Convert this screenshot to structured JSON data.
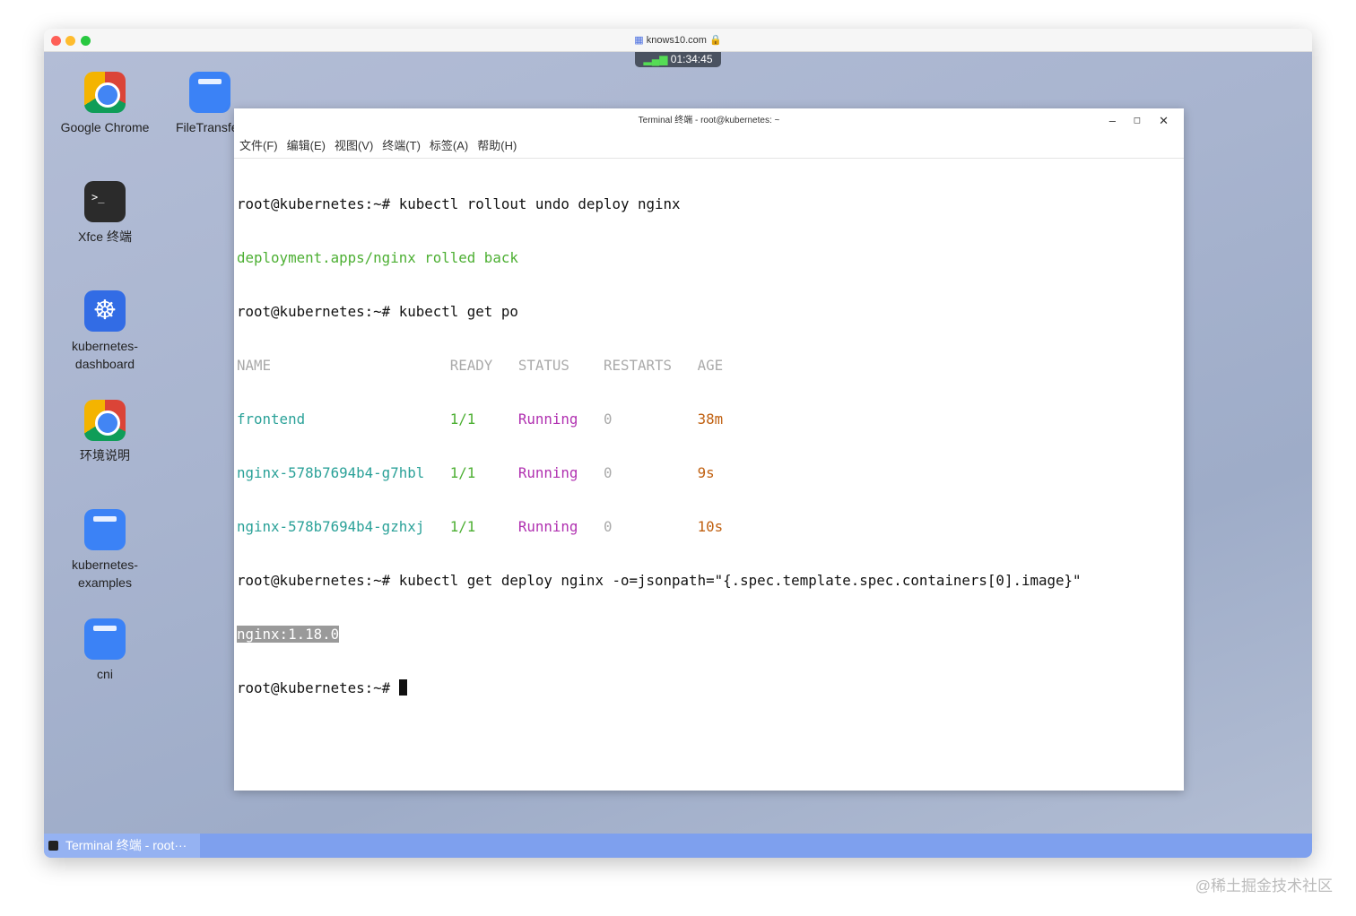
{
  "browser": {
    "url": "knows10.com",
    "timer": "01:34:45"
  },
  "desktop_icons": [
    {
      "label": "Google Chrome"
    },
    {
      "label": "FileTransfer"
    },
    {
      "label": "Xfce 终端"
    },
    {
      "label": "kubernetes-dashboard"
    },
    {
      "label": "环境说明"
    },
    {
      "label": "kubernetes-examples"
    },
    {
      "label": "cni"
    }
  ],
  "terminal": {
    "title": "Terminal 终端 - root@kubernetes: ~",
    "menu": [
      "文件(F)",
      "编辑(E)",
      "视图(V)",
      "终端(T)",
      "标签(A)",
      "帮助(H)"
    ],
    "lines": {
      "l1": "root@kubernetes:~# kubectl rollout undo deploy nginx",
      "l2": "deployment.apps/nginx rolled back",
      "l3": "root@kubernetes:~# kubectl get po",
      "l4": "root@kubernetes:~# kubectl get deploy nginx -o=jsonpath=\"{.spec.template.spec.containers[0].image}\"",
      "l5": "nginx:1.18.0",
      "prompt": "root@kubernetes:~# "
    },
    "table": {
      "headers": [
        "NAME",
        "READY",
        "STATUS",
        "RESTARTS",
        "AGE"
      ],
      "rows": [
        [
          "frontend",
          "1/1",
          "Running",
          "0",
          "38m"
        ],
        [
          "nginx-578b7694b4-g7hbl",
          "1/1",
          "Running",
          "0",
          "9s"
        ],
        [
          "nginx-578b7694b4-gzhxj",
          "1/1",
          "Running",
          "0",
          "10s"
        ]
      ]
    }
  },
  "taskbar": {
    "item": "Terminal 终端 - root···"
  },
  "watermark": "@稀土掘金技术社区"
}
